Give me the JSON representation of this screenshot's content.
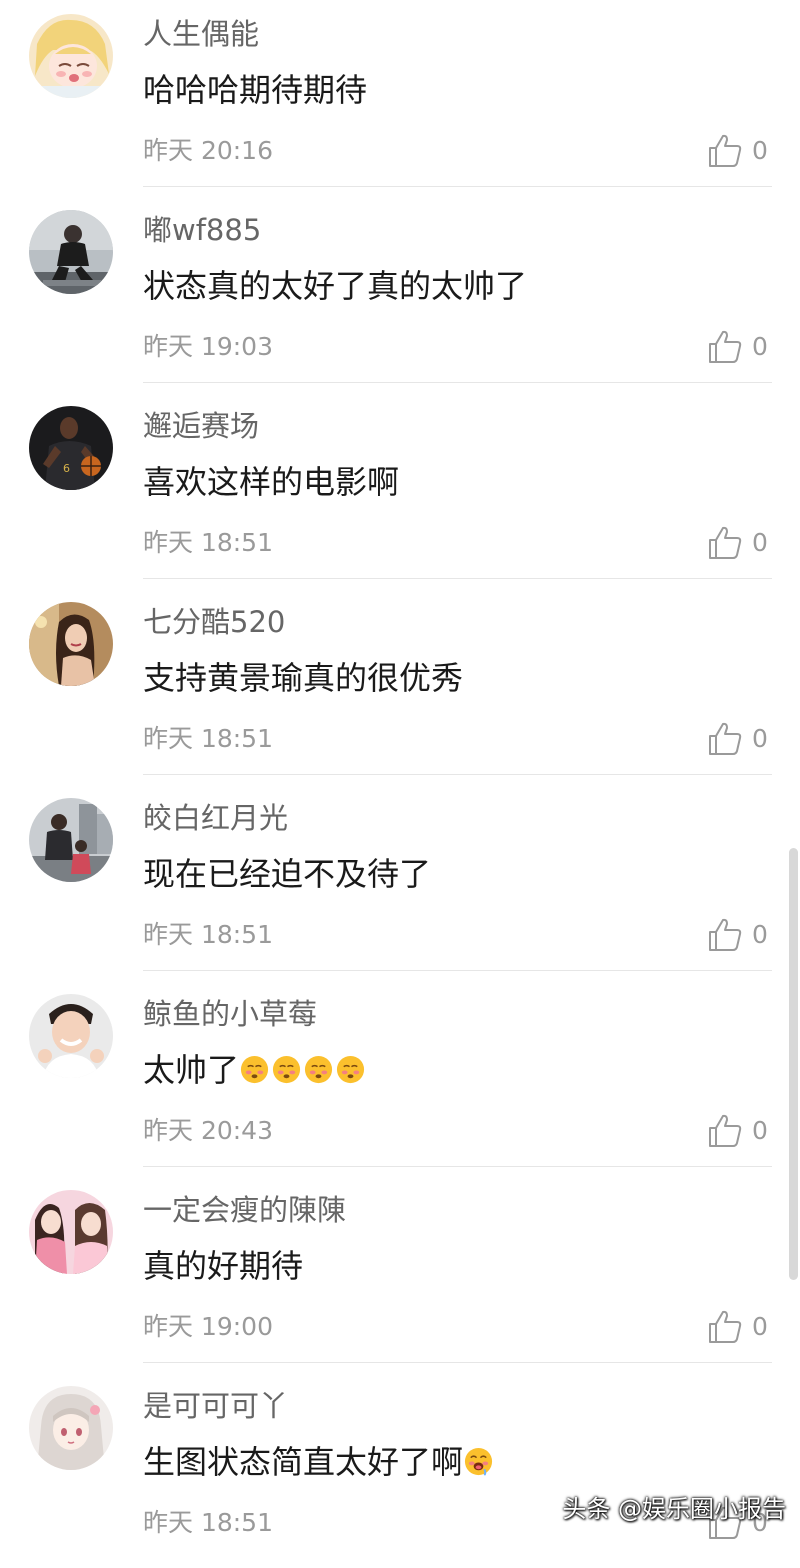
{
  "comments": [
    {
      "username": "人生偶能",
      "text": "哈哈哈期待期待",
      "time": "昨天 20:16",
      "likes": "0",
      "avatar": "anime-girl-avatar"
    },
    {
      "username": "嘟wf885",
      "text": "状态真的太好了真的太帅了",
      "time": "昨天 19:03",
      "likes": "0",
      "avatar": "man-crouching-avatar"
    },
    {
      "username": "邂逅赛场",
      "text": "喜欢这样的电影啊",
      "time": "昨天 18:51",
      "likes": "0",
      "avatar": "basketball-player-avatar"
    },
    {
      "username": "七分酷520",
      "text": "支持黄景瑜真的很优秀",
      "time": "昨天 18:51",
      "likes": "0",
      "avatar": "woman-portrait-avatar"
    },
    {
      "username": "皎白红月光",
      "text": "现在已经迫不及待了",
      "time": "昨天 18:51",
      "likes": "0",
      "avatar": "father-child-avatar"
    },
    {
      "username": "鲸鱼的小草莓",
      "text": "太帅了",
      "emojis": [
        "blushing-face-emoji",
        "blushing-face-emoji",
        "blushing-face-emoji",
        "blushing-face-emoji"
      ],
      "time": "昨天 20:43",
      "likes": "0",
      "avatar": "young-man-avatar"
    },
    {
      "username": "一定会瘦的陳陳",
      "text": "真的好期待",
      "time": "昨天 19:00",
      "likes": "0",
      "avatar": "pink-girls-avatar"
    },
    {
      "username": "是可可可丫",
      "text": "生图状态简直太好了啊",
      "emojis": [
        "drooling-face-emoji"
      ],
      "time": "昨天 18:51",
      "likes": "0",
      "avatar": "anime-character-avatar"
    }
  ],
  "icons": {
    "like": "thumbs-up-icon"
  },
  "watermark": "头条 @娱乐圈小报告",
  "colors": {
    "username": "#666666",
    "content": "#1a1a1a",
    "meta": "#9a9a9a",
    "divider": "#e6e6e6"
  }
}
